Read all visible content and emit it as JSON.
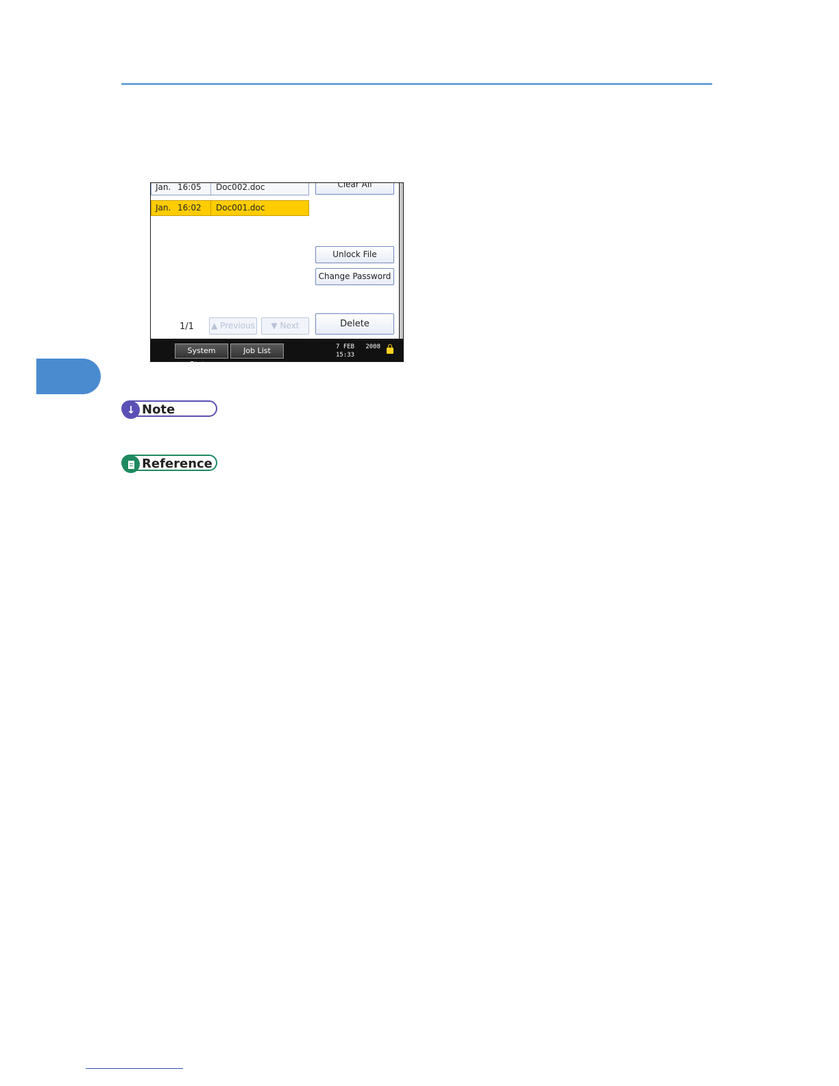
{
  "file_list": {
    "rows": [
      {
        "month": "Jan.",
        "time": "16:05",
        "name": "Doc002.doc"
      },
      {
        "month": "Jan.",
        "time": "16:02",
        "name": "Doc001.doc"
      }
    ],
    "page_indicator": "1/1"
  },
  "buttons": {
    "clear_all": "Clear All",
    "unlock_file": "Unlock File",
    "change_password": "Change Password",
    "delete": "Delete",
    "previous": "Previous",
    "next": "Next"
  },
  "taskbar": {
    "system_status": "System Status",
    "job_list": "Job List",
    "date": "7 FEB   2008",
    "time": "15:33"
  },
  "labels": {
    "note": "Note",
    "reference": "Reference"
  },
  "colors": {
    "header_rule": "#6fa3d6",
    "chapter_tab": "#4a8bd0",
    "selected_row": "#ffcc00",
    "note": "#5b50b5",
    "reference": "#1f8a60"
  }
}
